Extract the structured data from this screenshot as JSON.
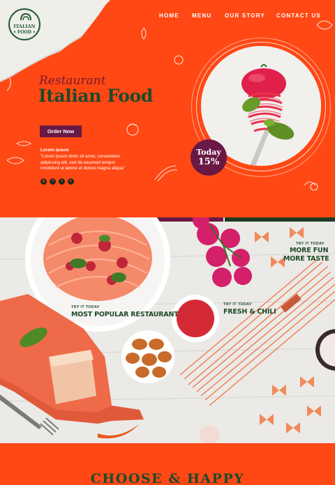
{
  "brand": {
    "logo_line1": "ITALIAN",
    "logo_line2": "• FOOD •"
  },
  "nav": [
    {
      "label": "HOME"
    },
    {
      "label": "MENU"
    },
    {
      "label": "OUR STORY"
    },
    {
      "label": "CONTACT US"
    }
  ],
  "hero": {
    "script_title": "Restaurant",
    "title": "Italian Food",
    "cta_label": "Order Now",
    "lorem_heading": "Lorem ipsum",
    "lorem_body": "\"Lorem ipsum dolor sit amet, consectetur adipiscing elit, sed do eiusmod tempor incididunt ut labore et dolore magna aliqua\"",
    "social_icons": [
      "instagram-icon",
      "facebook-icon",
      "twitter-icon",
      "youtube-icon"
    ],
    "badge_line1": "Today",
    "badge_line2": "15%"
  },
  "photo_labels": {
    "popular_small": "TRY IT TODAY",
    "popular_big": "MOST POPULAR RESTAURANT",
    "fresh_small": "TRY IT TODAY",
    "fresh_big": "FRESH & CHILI",
    "more_small": "TRY IT TODAY",
    "more_big1": "MORE FUN",
    "more_big2": "MORE TASTE"
  },
  "footer": {
    "headline": "CHOOSE & HAPPY"
  },
  "colors": {
    "accent": "#ff4814",
    "dark_green": "#1d4a2a",
    "plum": "#6a1845"
  }
}
